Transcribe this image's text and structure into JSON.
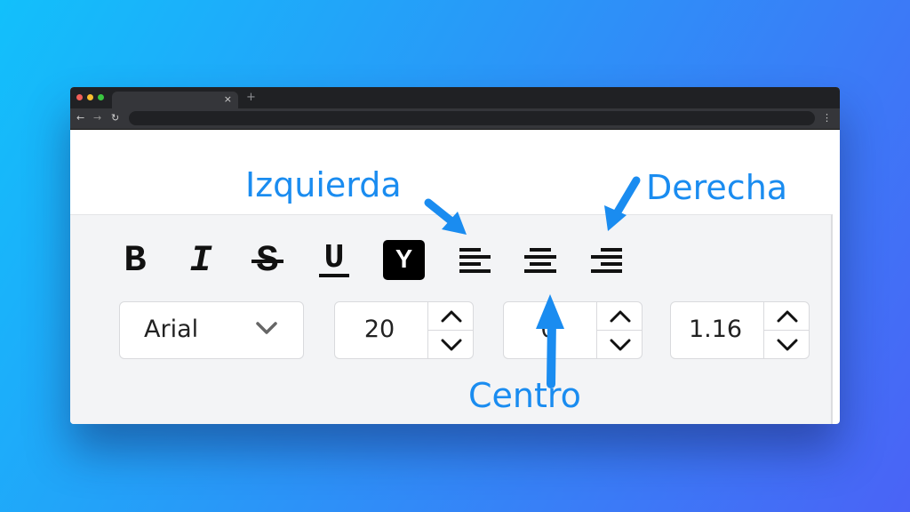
{
  "browser": {
    "tab_close": "×",
    "new_tab": "+",
    "back": "←",
    "forward": "→",
    "reload": "↻",
    "menu": "⋮"
  },
  "format_buttons": {
    "bold": "B",
    "italic": "I",
    "strikethrough": "S",
    "underline": "U",
    "highlight": "Y",
    "align_left_icon": "align-left-icon",
    "align_center_icon": "align-center-icon",
    "align_right_icon": "align-right-icon"
  },
  "font_select": {
    "value": "Arial"
  },
  "font_size": {
    "value": "20"
  },
  "letter_spacing": {
    "value": "0"
  },
  "line_height": {
    "value": "1.16"
  },
  "annotations": {
    "left": "Izquierda",
    "right": "Derecha",
    "center": "Centro",
    "color": "#1a8cf0"
  },
  "colors": {
    "background_start": "#12c0fb",
    "background_end": "#4a63f6",
    "panel": "#f3f4f6",
    "titlebar": "#202124"
  }
}
